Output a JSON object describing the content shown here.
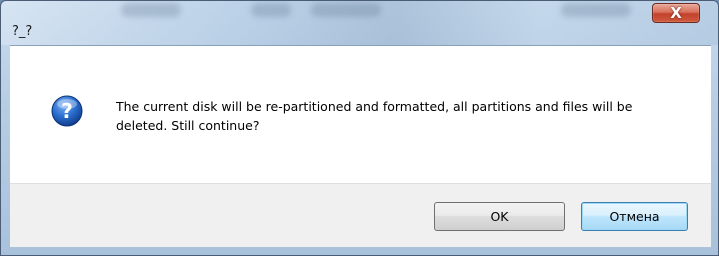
{
  "window": {
    "title": "?_?",
    "close_label": "X"
  },
  "dialog": {
    "icon": "question-icon",
    "message": "The current disk will be re-partitioned and formatted, all partitions and files will be deleted. Still continue?",
    "ok_label": "OK",
    "cancel_label": "Отмена"
  },
  "colors": {
    "window_frame": "#b7cde4",
    "close_button": "#c2422c",
    "icon_blue": "#1f5fc4",
    "footer": "#f0f0f0",
    "focused_button_border": "#3c7fb1"
  }
}
